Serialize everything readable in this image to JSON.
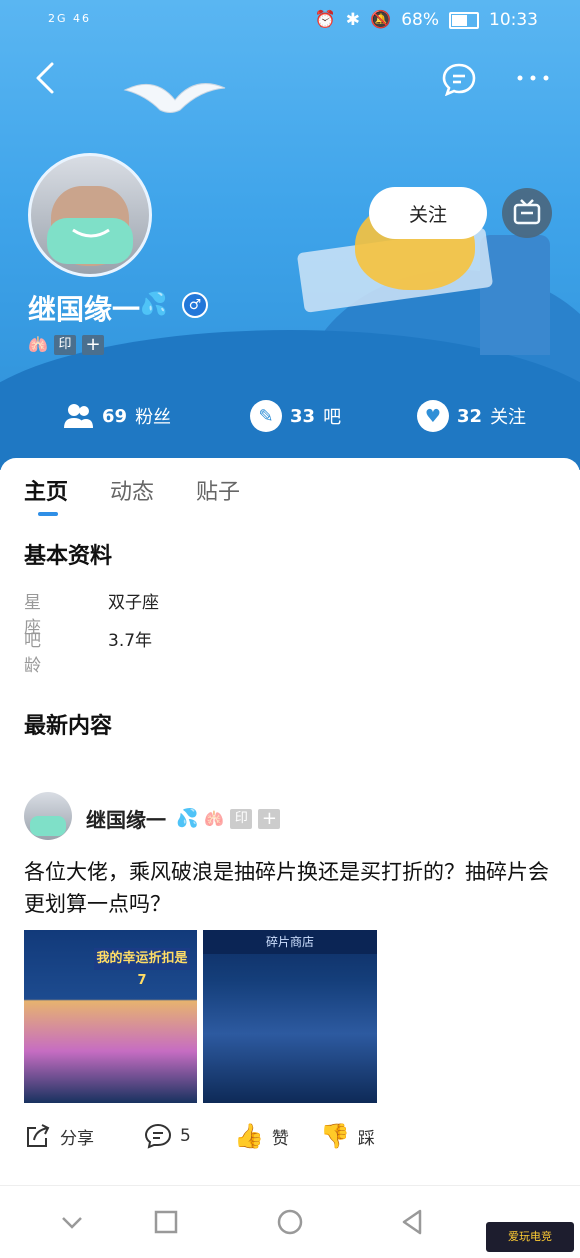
{
  "status_bar": {
    "signal_left": "2G 46",
    "battery_pct": "68%",
    "time": "10:33",
    "battery_level": 0.68
  },
  "profile": {
    "username": "继国缘一",
    "follow_label": "关注",
    "badge_yin": "印",
    "badge_plus": "+",
    "stats": {
      "fans_num": "69",
      "fans_label": "粉丝",
      "bars_num": "33",
      "bars_label": "吧",
      "following_num": "32",
      "following_label": "关注"
    }
  },
  "tabs": [
    "主页",
    "动态",
    "贴子"
  ],
  "basic_info": {
    "title": "基本资料",
    "rows": [
      {
        "key": "星座",
        "value": "双子座"
      },
      {
        "key": "吧龄",
        "value": "3.7年"
      }
    ]
  },
  "latest": {
    "title": "最新内容",
    "post": {
      "author": "继国缘一",
      "badge_yin": "印",
      "badge_plus": "+",
      "text": "各位大佬，乘风破浪是抽碎片换还是买打折的？抽碎片会更划算一点吗？",
      "img1_text": "我的幸运折扣是 7",
      "img2_text": "碎片商店",
      "actions": {
        "share": "分享",
        "comments": "5",
        "like": "赞",
        "dislike": "踩"
      }
    }
  },
  "watermark": "爱玩电竞"
}
